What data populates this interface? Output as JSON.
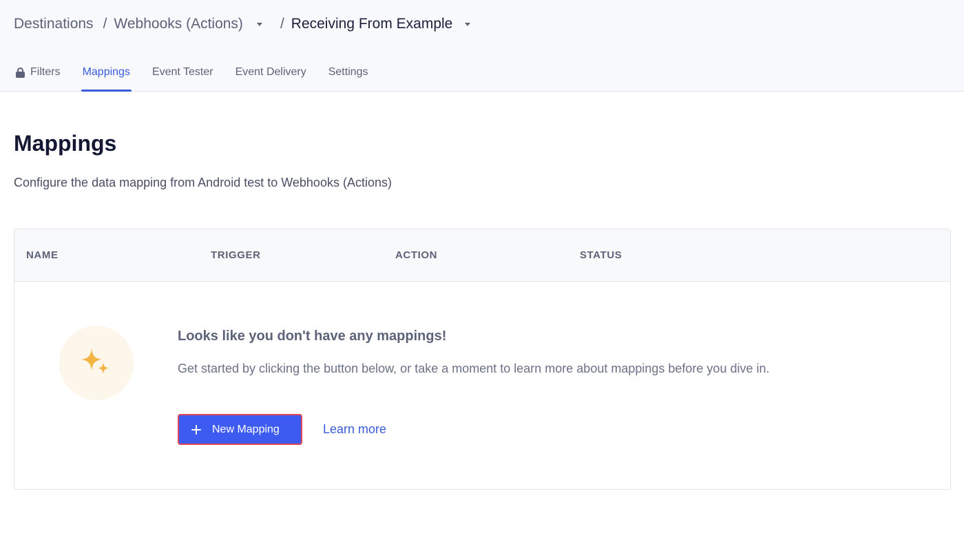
{
  "breadcrumb": {
    "items": [
      "Destinations",
      "Webhooks (Actions)",
      "Receiving From Example"
    ],
    "separator": "/"
  },
  "tabs": [
    {
      "label": "Filters",
      "icon": "lock-icon",
      "active": false
    },
    {
      "label": "Mappings",
      "active": true
    },
    {
      "label": "Event Tester",
      "active": false
    },
    {
      "label": "Event Delivery",
      "active": false
    },
    {
      "label": "Settings",
      "active": false
    }
  ],
  "main": {
    "title": "Mappings",
    "subtitle": "Configure the data mapping from Android test to Webhooks (Actions)"
  },
  "table": {
    "columns": [
      "NAME",
      "TRIGGER",
      "ACTION",
      "STATUS"
    ]
  },
  "empty_state": {
    "icon": "sparkles-icon",
    "title": "Looks like you don't have any mappings!",
    "description": "Get started by clicking the button below, or take a moment to learn more about mappings before you dive in.",
    "new_button_label": "New Mapping",
    "learn_more_label": "Learn more"
  },
  "colors": {
    "accent": "#3d5bf0",
    "link": "#3b5bdb",
    "sparkle": "#f2b544",
    "button_outline": "#e04a57"
  }
}
